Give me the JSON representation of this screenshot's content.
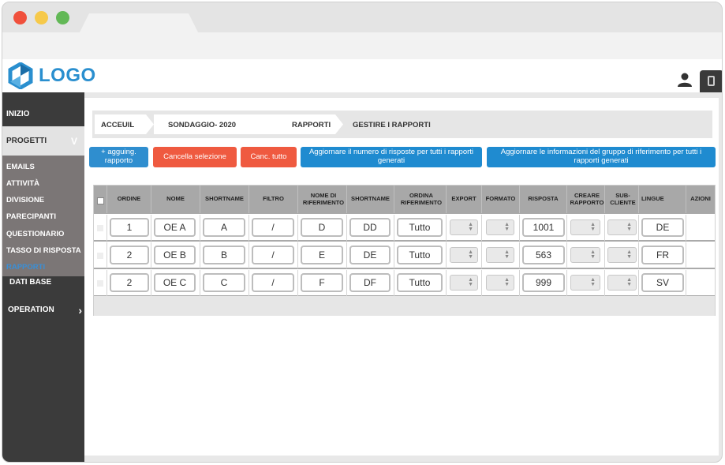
{
  "header": {
    "logo_text": "LOGO"
  },
  "sidebar": {
    "inizio": "INIZIO",
    "progetti": "PROGETTI",
    "progetti_chevron": "V",
    "submenu": [
      "EMAILS",
      "ATTIVITÀ",
      "DIVISIONE",
      "PARECIPANTI",
      "QUESTIONARIO",
      "TASSO DI RISPOSTA",
      "RAPPORTI"
    ],
    "dati_base": "DATI BASE",
    "operation": "OPERATION"
  },
  "breadcrumb": [
    "ACCEUIL",
    "SONDAGGIO- 2020",
    "RAPPORTI",
    "GESTIRE I RAPPORTI"
  ],
  "actions": {
    "add": "+ agguing. rapporto",
    "cancel_selection": "Cancella selezione",
    "cancel_all": "Canc. tutto",
    "update_responses": "Aggiornare il numero di risposte per tutti i rapporti generati",
    "update_group": "Aggiornare le informazioni del gruppo di riferimento per tutti i rapporti generati"
  },
  "table": {
    "columns": [
      "ORDINE",
      "NOME",
      "SHORTNAME",
      "FILTRO",
      "NOME DI RIFERIMENTO",
      "SHORTNAME",
      "ORDINA RIFERIMENTO",
      "EXPORT",
      "FORMATO",
      "RISPOSTA",
      "CREARE RAPPORTO",
      "SUB-CLIENTE",
      "LINGUE",
      "AZIONI"
    ],
    "rows": [
      {
        "ordine": "1",
        "nome": "OE A",
        "shortname": "A",
        "filtro": "/",
        "nome_rif": "D",
        "short_rif": "DD",
        "ordina": "Tutto",
        "risposta": "1001",
        "lingue": "DE"
      },
      {
        "ordine": "2",
        "nome": "OE B",
        "shortname": "B",
        "filtro": "/",
        "nome_rif": "E",
        "short_rif": "DE",
        "ordina": "Tutto",
        "risposta": "563",
        "lingue": "FR"
      },
      {
        "ordine": "2",
        "nome": "OE C",
        "shortname": "C",
        "filtro": "/",
        "nome_rif": "F",
        "short_rif": "DF",
        "ordina": "Tutto",
        "risposta": "999",
        "lingue": "SV"
      }
    ]
  }
}
